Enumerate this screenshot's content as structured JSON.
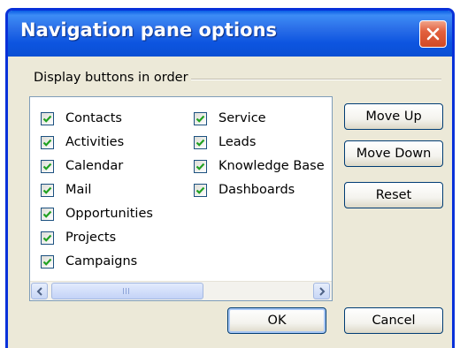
{
  "dialog": {
    "title": "Navigation pane options",
    "group_label": "Display buttons in order"
  },
  "items_col1": [
    {
      "label": "Contacts",
      "checked": true
    },
    {
      "label": "Activities",
      "checked": true
    },
    {
      "label": "Calendar",
      "checked": true
    },
    {
      "label": "Mail",
      "checked": true
    },
    {
      "label": "Opportunities",
      "checked": true
    },
    {
      "label": "Projects",
      "checked": true
    },
    {
      "label": "Campaigns",
      "checked": true
    }
  ],
  "items_col2": [
    {
      "label": "Service",
      "checked": true
    },
    {
      "label": "Leads",
      "checked": true
    },
    {
      "label": "Knowledge Base",
      "checked": true
    },
    {
      "label": "Dashboards",
      "checked": true
    }
  ],
  "buttons": {
    "move_up": "Move Up",
    "move_down": "Move Down",
    "reset": "Reset",
    "ok": "OK",
    "cancel": "Cancel"
  },
  "colors": {
    "titlebar": "#0a4fd4",
    "checkmark": "#21a121",
    "close": "#d14a26"
  }
}
